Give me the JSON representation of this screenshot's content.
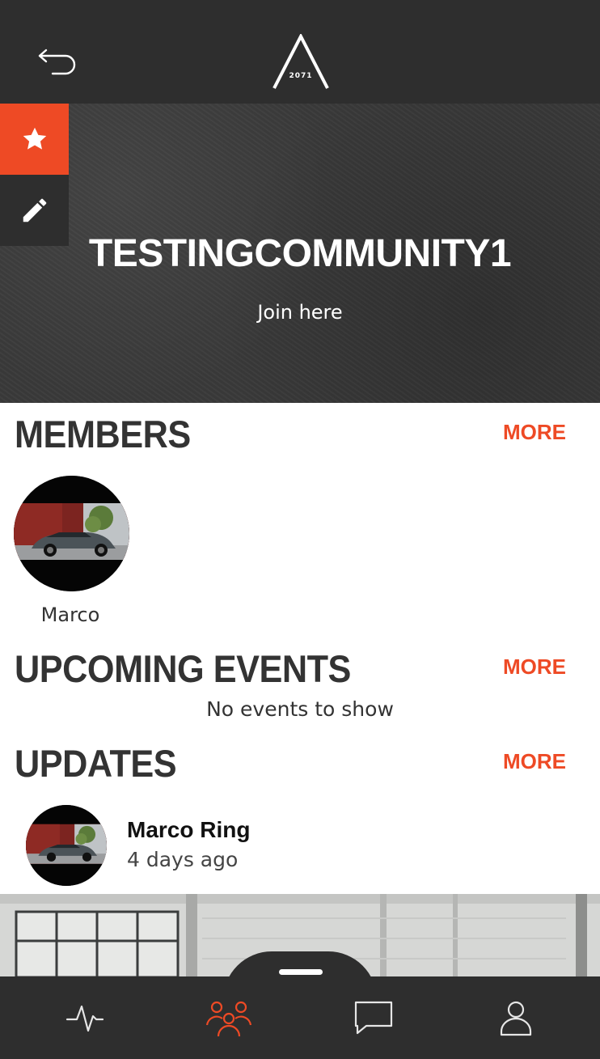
{
  "header": {
    "back_icon": "undo-arrow-icon",
    "logo_text": "2071"
  },
  "community": {
    "title": "TESTINGCOMMUNITY1",
    "join_label": "Join here",
    "favorite_icon": "star-icon",
    "edit_icon": "pencil-icon"
  },
  "members": {
    "title": "MEMBERS",
    "more_label": "MORE",
    "items": [
      {
        "name": "Marco"
      }
    ]
  },
  "events": {
    "title": "UPCOMING EVENTS",
    "more_label": "MORE",
    "empty_text": "No events to show"
  },
  "updates": {
    "title": "UPDATES",
    "more_label": "MORE",
    "items": [
      {
        "author": "Marco Ring",
        "time": "4 days ago"
      }
    ]
  },
  "bottom_nav": [
    {
      "icon": "activity-pulse-icon",
      "active": false
    },
    {
      "icon": "community-group-icon",
      "active": true
    },
    {
      "icon": "chat-bubble-icon",
      "active": false
    },
    {
      "icon": "profile-user-icon",
      "active": false
    }
  ],
  "colors": {
    "accent": "#ee4a25",
    "dark_bar": "#2e2e2e",
    "text": "#333333"
  }
}
